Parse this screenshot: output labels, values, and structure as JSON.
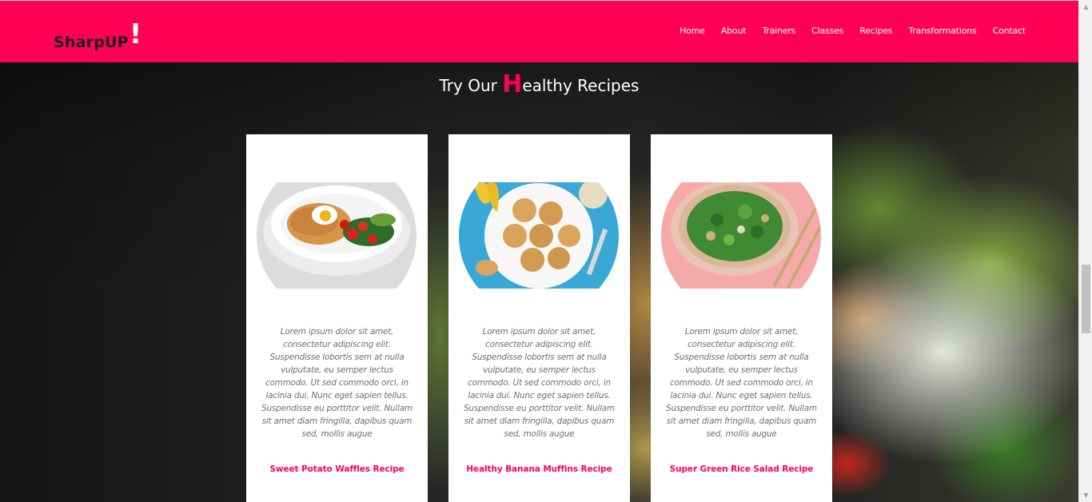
{
  "brand": {
    "name": "SharpUP",
    "mark": "!"
  },
  "nav": {
    "items": [
      "Home",
      "About",
      "Trainers",
      "Classes",
      "Recipes",
      "Transformations",
      "Contact"
    ]
  },
  "section": {
    "title_before": "Try Our ",
    "title_highlight": "H",
    "title_after": "ealthy Recipes"
  },
  "recipes": [
    {
      "description": "Lorem ipsum dolor sit amet, consectetur adipiscing elit. Suspendisse lobortis sem at nulla vulputate, eu semper lectus commodo. Ut sed commodo orci, in lacinia dui. Nunc eget sapien tellus. Suspendisse eu porttitor velit. Nullam sit amet diam fringilla, dapibus quam sed, mollis augue",
      "link": "Sweet Potato Waffles Recipe",
      "image": "waffles-plate"
    },
    {
      "description": "Lorem ipsum dolor sit amet, consectetur adipiscing elit. Suspendisse lobortis sem at nulla vulputate, eu semper lectus commodo. Ut sed commodo orci, in lacinia dui. Nunc eget sapien tellus. Suspendisse eu porttitor velit. Nullam sit amet diam fringilla, dapibus quam sed, mollis augue",
      "link": "Healthy Banana Muffins Recipe",
      "image": "muffins-plate"
    },
    {
      "description": "Lorem ipsum dolor sit amet, consectetur adipiscing elit. Suspendisse lobortis sem at nulla vulputate, eu semper lectus commodo. Ut sed commodo orci, in lacinia dui. Nunc eget sapien tellus. Suspendisse eu porttitor velit. Nullam sit amet diam fringilla, dapibus quam sed, mollis augue",
      "link": "Super Green Rice Salad Recipe",
      "image": "salad-plate"
    }
  ],
  "colors": {
    "accent": "#ff0055",
    "header_bg": "#ff0055",
    "card_bg": "#ffffff",
    "text_muted": "#6f6f6f"
  }
}
